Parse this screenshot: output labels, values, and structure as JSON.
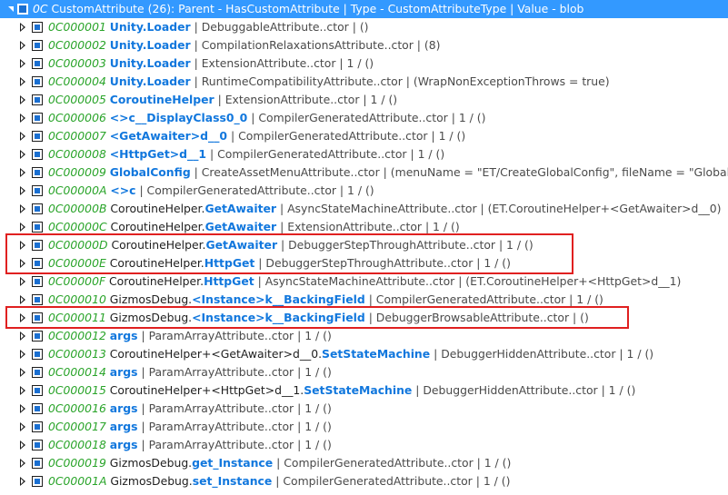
{
  "header": {
    "token": "0C",
    "text": " CustomAttribute (26): Parent - HasCustomAttribute | Type - CustomAttributeType | Value - blob"
  },
  "rows": [
    [
      [
        "token",
        "0C000001"
      ],
      [
        "plain",
        " "
      ],
      [
        "hl",
        "Unity.Loader"
      ],
      [
        "dim",
        " | DebuggableAttribute..ctor | ()"
      ]
    ],
    [
      [
        "token",
        "0C000002"
      ],
      [
        "plain",
        " "
      ],
      [
        "hl",
        "Unity.Loader"
      ],
      [
        "dim",
        " | CompilationRelaxationsAttribute..ctor | (8)"
      ]
    ],
    [
      [
        "token",
        "0C000003"
      ],
      [
        "plain",
        " "
      ],
      [
        "hl",
        "Unity.Loader"
      ],
      [
        "dim",
        " | ExtensionAttribute..ctor | 1 / ()"
      ]
    ],
    [
      [
        "token",
        "0C000004"
      ],
      [
        "plain",
        " "
      ],
      [
        "hl",
        "Unity.Loader"
      ],
      [
        "dim",
        " | RuntimeCompatibilityAttribute..ctor | (WrapNonExceptionThrows = true)"
      ]
    ],
    [
      [
        "token",
        "0C000005"
      ],
      [
        "plain",
        " "
      ],
      [
        "hl",
        "CoroutineHelper"
      ],
      [
        "dim",
        " | ExtensionAttribute..ctor | 1 / ()"
      ]
    ],
    [
      [
        "token",
        "0C000006"
      ],
      [
        "plain",
        " "
      ],
      [
        "hl",
        "<>c__DisplayClass0_0"
      ],
      [
        "dim",
        " | CompilerGeneratedAttribute..ctor | 1 / ()"
      ]
    ],
    [
      [
        "token",
        "0C000007"
      ],
      [
        "plain",
        " "
      ],
      [
        "hl",
        "<GetAwaiter>d__0"
      ],
      [
        "dim",
        " | CompilerGeneratedAttribute..ctor | 1 / ()"
      ]
    ],
    [
      [
        "token",
        "0C000008"
      ],
      [
        "plain",
        " "
      ],
      [
        "hl",
        "<HttpGet>d__1"
      ],
      [
        "dim",
        " | CompilerGeneratedAttribute..ctor | 1 / ()"
      ]
    ],
    [
      [
        "token",
        "0C000009"
      ],
      [
        "plain",
        " "
      ],
      [
        "hl",
        "GlobalConfig"
      ],
      [
        "dim",
        " | CreateAssetMenuAttribute..ctor | (menuName = \"ET/CreateGlobalConfig\", fileName = \"GlobalConfig\", o"
      ]
    ],
    [
      [
        "token",
        "0C00000A"
      ],
      [
        "plain",
        " "
      ],
      [
        "hl",
        "<>c"
      ],
      [
        "dim",
        " | CompilerGeneratedAttribute..ctor | 1 / ()"
      ]
    ],
    [
      [
        "token",
        "0C00000B"
      ],
      [
        "plain",
        " CoroutineHelper."
      ],
      [
        "hl",
        "GetAwaiter"
      ],
      [
        "dim",
        " | AsyncStateMachineAttribute..ctor | (ET.CoroutineHelper+<GetAwaiter>d__0)"
      ]
    ],
    [
      [
        "token",
        "0C00000C"
      ],
      [
        "plain",
        " CoroutineHelper."
      ],
      [
        "hl",
        "GetAwaiter"
      ],
      [
        "dim",
        " | ExtensionAttribute..ctor | 1 / ()"
      ]
    ],
    [
      [
        "token",
        "0C00000D"
      ],
      [
        "plain",
        " CoroutineHelper."
      ],
      [
        "hl",
        "GetAwaiter"
      ],
      [
        "dim",
        " | DebuggerStepThroughAttribute..ctor | 1 / ()"
      ]
    ],
    [
      [
        "token",
        "0C00000E"
      ],
      [
        "plain",
        " CoroutineHelper."
      ],
      [
        "hl",
        "HttpGet"
      ],
      [
        "dim",
        " | DebuggerStepThroughAttribute..ctor | 1 / ()"
      ]
    ],
    [
      [
        "token",
        "0C00000F"
      ],
      [
        "plain",
        " CoroutineHelper."
      ],
      [
        "hl",
        "HttpGet"
      ],
      [
        "dim",
        " | AsyncStateMachineAttribute..ctor | (ET.CoroutineHelper+<HttpGet>d__1)"
      ]
    ],
    [
      [
        "token",
        "0C000010"
      ],
      [
        "plain",
        " GizmosDebug."
      ],
      [
        "hl",
        "<Instance>k__BackingField"
      ],
      [
        "dim",
        " | CompilerGeneratedAttribute..ctor | 1 / ()"
      ]
    ],
    [
      [
        "token",
        "0C000011"
      ],
      [
        "plain",
        " GizmosDebug."
      ],
      [
        "hl",
        "<Instance>k__BackingField"
      ],
      [
        "dim",
        " | DebuggerBrowsableAttribute..ctor | ()"
      ]
    ],
    [
      [
        "token",
        "0C000012"
      ],
      [
        "plain",
        " "
      ],
      [
        "hl",
        "args"
      ],
      [
        "dim",
        " | ParamArrayAttribute..ctor | 1 / ()"
      ]
    ],
    [
      [
        "token",
        "0C000013"
      ],
      [
        "plain",
        " CoroutineHelper+<GetAwaiter>d__0."
      ],
      [
        "hl",
        "SetStateMachine"
      ],
      [
        "dim",
        " | DebuggerHiddenAttribute..ctor | 1 / ()"
      ]
    ],
    [
      [
        "token",
        "0C000014"
      ],
      [
        "plain",
        " "
      ],
      [
        "hl",
        "args"
      ],
      [
        "dim",
        " | ParamArrayAttribute..ctor | 1 / ()"
      ]
    ],
    [
      [
        "token",
        "0C000015"
      ],
      [
        "plain",
        " CoroutineHelper+<HttpGet>d__1."
      ],
      [
        "hl",
        "SetStateMachine"
      ],
      [
        "dim",
        " | DebuggerHiddenAttribute..ctor | 1 / ()"
      ]
    ],
    [
      [
        "token",
        "0C000016"
      ],
      [
        "plain",
        " "
      ],
      [
        "hl",
        "args"
      ],
      [
        "dim",
        " | ParamArrayAttribute..ctor | 1 / ()"
      ]
    ],
    [
      [
        "token",
        "0C000017"
      ],
      [
        "plain",
        " "
      ],
      [
        "hl",
        "args"
      ],
      [
        "dim",
        " | ParamArrayAttribute..ctor | 1 / ()"
      ]
    ],
    [
      [
        "token",
        "0C000018"
      ],
      [
        "plain",
        " "
      ],
      [
        "hl",
        "args"
      ],
      [
        "dim",
        " | ParamArrayAttribute..ctor | 1 / ()"
      ]
    ],
    [
      [
        "token",
        "0C000019"
      ],
      [
        "plain",
        " GizmosDebug."
      ],
      [
        "hl",
        "get_Instance"
      ],
      [
        "dim",
        " | CompilerGeneratedAttribute..ctor | 1 / ()"
      ]
    ],
    [
      [
        "token",
        "0C00001A"
      ],
      [
        "plain",
        " GizmosDebug."
      ],
      [
        "hl",
        "set_Instance"
      ],
      [
        "dim",
        " | CompilerGeneratedAttribute..ctor | 1 / ()"
      ]
    ]
  ],
  "highlight_groups": [
    [
      12,
      13
    ],
    [
      16
    ]
  ],
  "icon_colors": {
    "frame": "#1e1e1e",
    "fill": "#1a6fd1"
  }
}
